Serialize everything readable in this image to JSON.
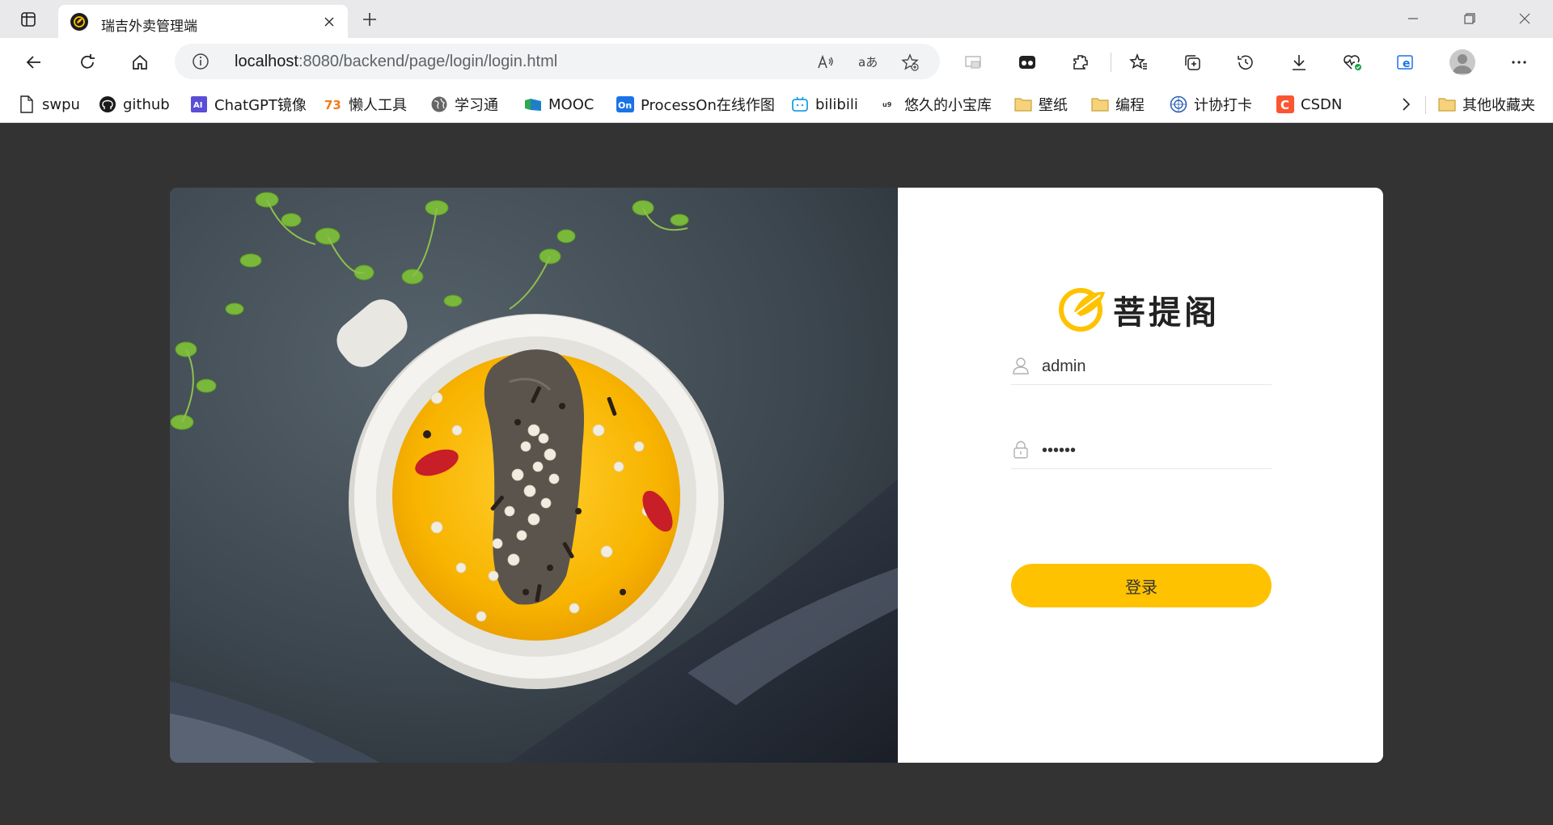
{
  "browser": {
    "tab": {
      "title": "瑞吉外卖管理端"
    },
    "address": {
      "host": "localhost",
      "path": ":8080/backend/page/login/login.html"
    },
    "bookmarks": [
      {
        "label": "swpu",
        "icon": "page-icon"
      },
      {
        "label": "github",
        "icon": "github-icon"
      },
      {
        "label": "ChatGPT镜像",
        "icon": "ai-icon"
      },
      {
        "label": "懒人工具",
        "icon": "tools-icon"
      },
      {
        "label": "学习通",
        "icon": "globe-icon"
      },
      {
        "label": "MOOC",
        "icon": "mooc-icon"
      },
      {
        "label": "ProcessOn在线作图",
        "icon": "processon-icon"
      },
      {
        "label": "bilibili",
        "icon": "bilibili-icon"
      },
      {
        "label": "悠久的小宝库",
        "icon": "u9-icon"
      },
      {
        "label": "壁纸",
        "icon": "folder-icon"
      },
      {
        "label": "编程",
        "icon": "folder-icon"
      },
      {
        "label": "计协打卡",
        "icon": "club-icon"
      },
      {
        "label": "CSDN",
        "icon": "csdn-icon"
      }
    ],
    "other_bookmarks": "其他收藏夹",
    "colors": {
      "accent": "#ffc200",
      "page_bg": "#333333"
    }
  },
  "login": {
    "brand": "菩提阁",
    "username": "admin",
    "password": "••••••",
    "submit_label": "登录"
  }
}
